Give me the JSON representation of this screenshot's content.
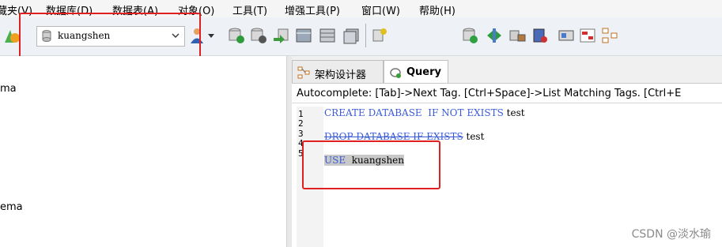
{
  "menu": [
    "藏夹(V)",
    "数据库(D)",
    "数据表(A)",
    "对象(O)",
    "工具(T)",
    "增强工具(P)",
    "窗口(W)",
    "帮助(H)"
  ],
  "toolbar": {
    "database_selected": "kuangshen"
  },
  "tabs": [
    {
      "label": "架构设计器",
      "icon": "schema-designer-icon"
    },
    {
      "label": "Query",
      "icon": "query-icon"
    }
  ],
  "left_panel": {
    "items": [
      "ma",
      "ema"
    ]
  },
  "editor": {
    "hint": "Autocomplete: [Tab]->Next Tag. [Ctrl+Space]->List Matching Tags. [Ctrl+E",
    "line_numbers": [
      "1",
      "2",
      "3",
      "4",
      "5"
    ],
    "line1": {
      "kw": "CREATE DATABASE  IF NOT EXISTS",
      "rest": " test"
    },
    "line3": {
      "kw": "DROP DATABASE IF EXISTS",
      "rest": " test"
    },
    "line5": {
      "kw": "USE",
      "rest": "  kuangshen"
    }
  },
  "watermark": "CSDN @淡水瑜",
  "colors": {
    "keyword": "#3a5bd7",
    "highlight_box": "#e02020"
  }
}
